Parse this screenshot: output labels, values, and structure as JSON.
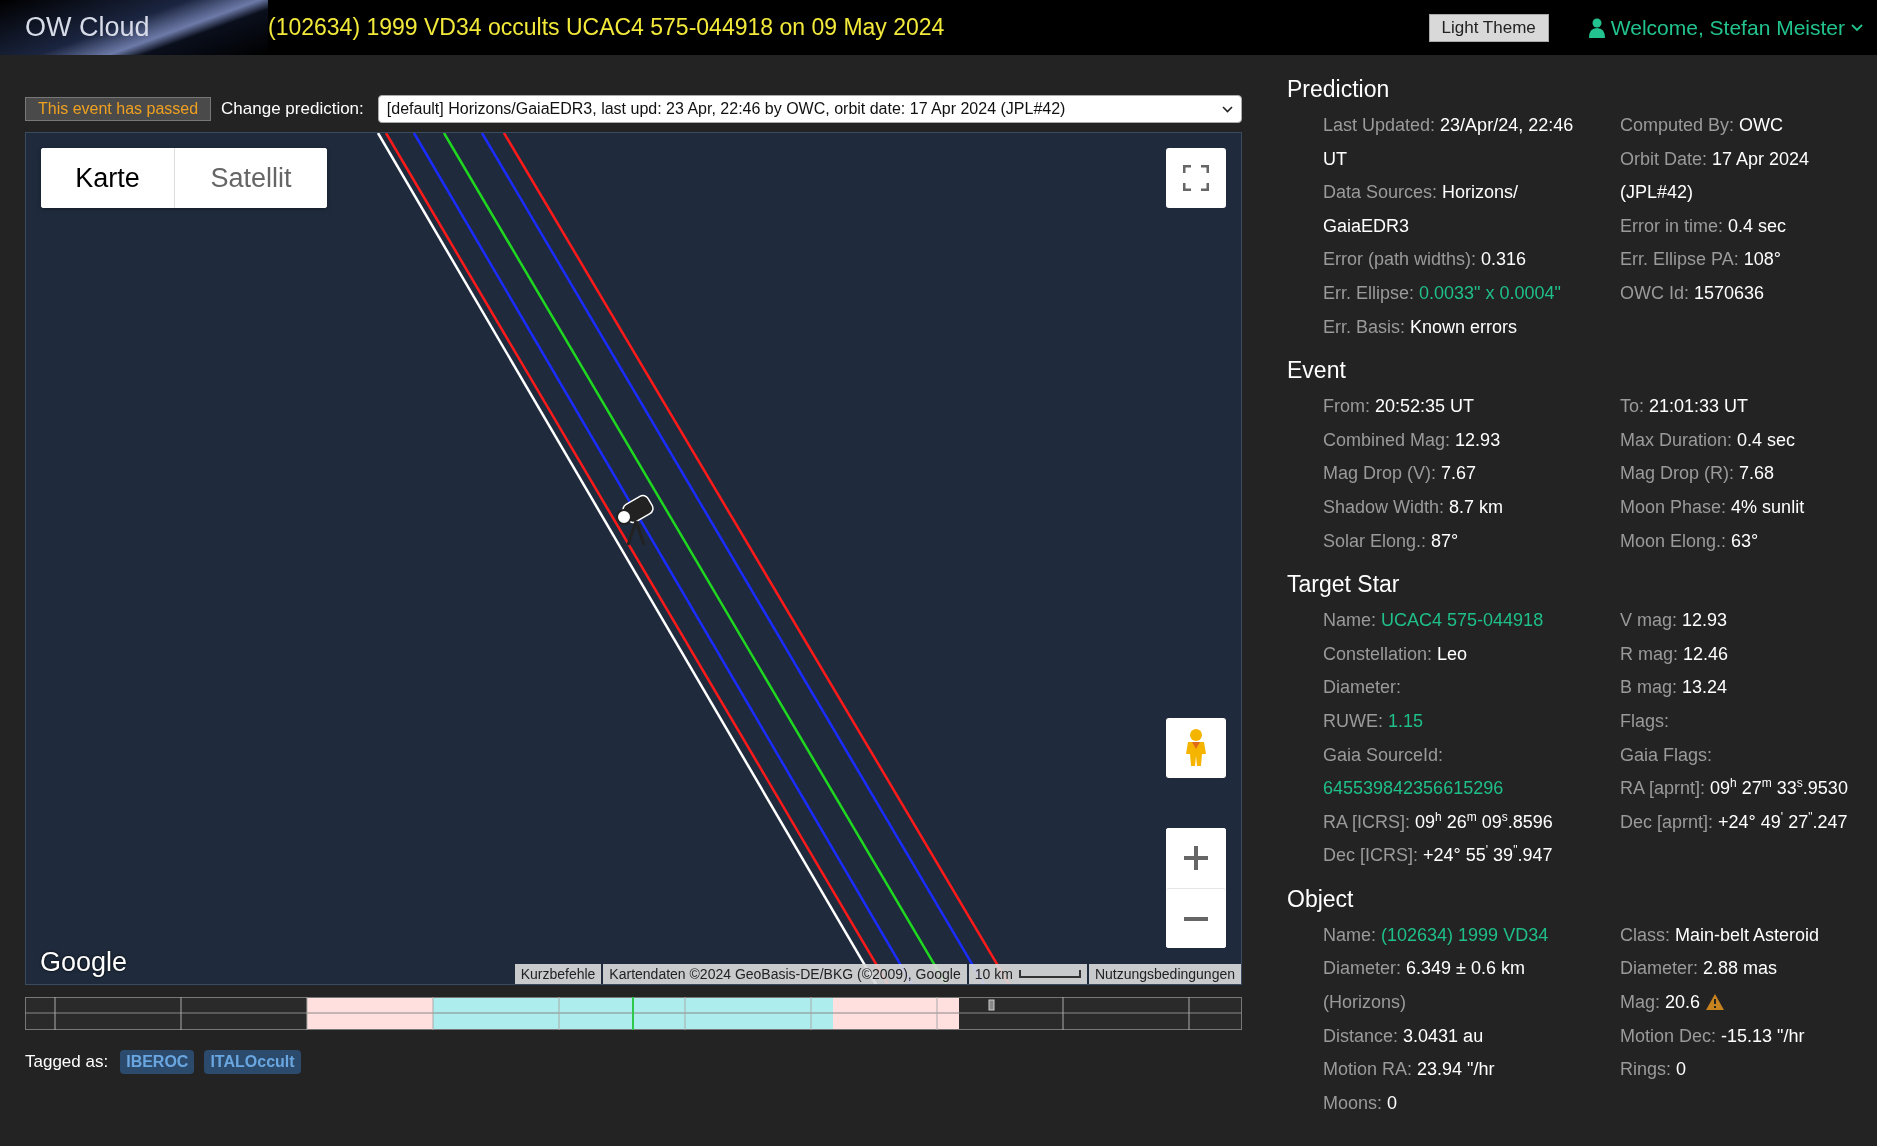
{
  "header": {
    "logo": "OW Cloud",
    "title": "(102634) 1999 VD34 occults UCAC4 575-044918 on 09 May 2024",
    "theme_button": "Light Theme",
    "welcome": "Welcome, Stefan Meister"
  },
  "event_bar": {
    "status": "This event has passed",
    "label": "Change prediction:",
    "prediction": "[default] Horizons/GaiaEDR3, last upd: 23 Apr, 22:46 by OWC, orbit date: 17 Apr 2024 (JPL#42)"
  },
  "map": {
    "map_types": [
      {
        "label": "Karte",
        "selected": true
      },
      {
        "label": "Satellit",
        "selected": false
      }
    ],
    "logo": "Google",
    "attribution": [
      {
        "text": "Kurzbefehle",
        "kind": "link"
      },
      {
        "text": "Kartendaten ©2024 GeoBasis-DE/BKG (©2009), Google",
        "kind": "text"
      },
      {
        "text": "10 km",
        "kind": "scale"
      },
      {
        "text": "Nutzungsbedingungen",
        "kind": "link"
      }
    ]
  },
  "tags": {
    "label": "Tagged as:",
    "items": [
      "IBEROC",
      "ITALOccult"
    ]
  },
  "sections": [
    {
      "title": "Prediction",
      "columns": [
        [
          {
            "label": "Last Updated:",
            "value": "23/Apr/24, 22:46 UT",
            "kind": "text"
          },
          {
            "label": "Data Sources:",
            "value": "Horizons/ GaiaEDR3",
            "kind": "text"
          },
          {
            "label": "Error (path widths):",
            "value": "0.316",
            "kind": "text"
          },
          {
            "label": "Err. Ellipse:",
            "value": "0.0033\" x 0.0004\"",
            "kind": "link"
          },
          {
            "label": "Err. Basis:",
            "value": "Known errors",
            "kind": "text"
          }
        ],
        [
          {
            "label": "Computed By:",
            "value": "OWC",
            "kind": "text"
          },
          {
            "label": "Orbit Date:",
            "value": "17 Apr 2024 (JPL#42)",
            "kind": "text"
          },
          {
            "label": "Error in time:",
            "value": "0.4 sec",
            "kind": "text"
          },
          {
            "label": "Err. Ellipse PA:",
            "value": "108°",
            "kind": "text"
          },
          {
            "label": "OWC Id:",
            "value": "1570636",
            "kind": "text"
          }
        ]
      ]
    },
    {
      "title": "Event",
      "columns": [
        [
          {
            "label": "From:",
            "value": "20:52:35 UT",
            "kind": "text"
          },
          {
            "label": "Combined Mag:",
            "value": "12.93",
            "kind": "text"
          },
          {
            "label": "Mag Drop (V):",
            "value": "7.67",
            "kind": "text"
          },
          {
            "label": "Shadow Width:",
            "value": "8.7 km",
            "kind": "text"
          },
          {
            "label": "Solar Elong.:",
            "value": "87°",
            "kind": "text"
          }
        ],
        [
          {
            "label": "To:",
            "value": "21:01:33 UT",
            "kind": "text"
          },
          {
            "label": "Max Duration:",
            "value": "0.4 sec",
            "kind": "text"
          },
          {
            "label": "Mag Drop (R):",
            "value": "7.68",
            "kind": "text"
          },
          {
            "label": "Moon Phase:",
            "value": "4% sunlit",
            "kind": "text"
          },
          {
            "label": "Moon Elong.:",
            "value": "63°",
            "kind": "text"
          }
        ]
      ]
    },
    {
      "title": "Target Star",
      "columns": [
        [
          {
            "label": "Name:",
            "value": "UCAC4 575-044918",
            "kind": "link"
          },
          {
            "label": "Constellation:",
            "value": "Leo",
            "kind": "text"
          },
          {
            "label": "Diameter:"
          },
          {
            "label": "RUWE:",
            "value": "1.15",
            "kind": "link"
          },
          {
            "label": "Gaia SourceId:",
            "value": "645539842356615296",
            "kind": "link"
          },
          {
            "label": "RA [ICRS]:",
            "value": "09$^{h}$ 26$^{m}$ 09$^{s}$.8596",
            "kind": "text"
          },
          {
            "label": "Dec [ICRS]:",
            "value": "+24° 55$^{'}$ 39$^{\"}$.947",
            "kind": "text"
          }
        ],
        [
          {
            "label": "V mag:",
            "value": "12.93",
            "kind": "text"
          },
          {
            "label": "R mag:",
            "value": "12.46",
            "kind": "text"
          },
          {
            "label": "B mag:",
            "value": "13.24",
            "kind": "text"
          },
          {
            "label": "Flags:"
          },
          {
            "label": "Gaia Flags:"
          },
          {
            "label": "RA [aprnt]:",
            "value": "09$^{h}$ 27$^{m}$ 33$^{s}$.9530",
            "kind": "text"
          },
          {
            "label": "Dec [aprnt]:",
            "value": "+24° 49$^{'}$ 27$^{\"}$.247",
            "kind": "text"
          }
        ]
      ]
    },
    {
      "title": "Object",
      "columns": [
        [
          {
            "label": "Name:",
            "value": "(102634) 1999 VD34",
            "kind": "link"
          },
          {
            "label": "Diameter:",
            "value": "6.349 ± 0.6 km",
            "note": "(Horizons)",
            "kind": "text"
          },
          {
            "label": "Distance:",
            "value": "3.0431 au",
            "kind": "text"
          },
          {
            "label": "Motion RA:",
            "value": "23.94 \"/hr",
            "kind": "text"
          },
          {
            "label": "Moons:",
            "value": "0",
            "kind": "text"
          }
        ],
        [
          {
            "label": "Class:",
            "value": "Main-belt Asteroid",
            "kind": "text"
          },
          {
            "label": "Diameter:",
            "value": "2.88 mas",
            "kind": "text"
          },
          {
            "label": "Mag:",
            "value": "20.6",
            "kind": "text",
            "warning": true
          },
          {
            "label": "Motion Dec:",
            "value": "-15.13 \"/hr",
            "kind": "text"
          },
          {
            "label": "Rings:",
            "value": "0",
            "kind": "text"
          }
        ]
      ]
    }
  ]
}
